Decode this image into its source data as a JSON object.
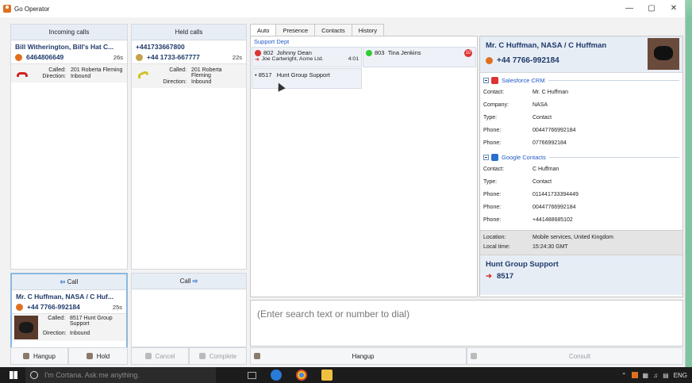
{
  "window": {
    "title": "Go Operator",
    "controls": [
      "—",
      "▢",
      "✕"
    ]
  },
  "incoming": {
    "header": "Incoming calls",
    "name": "Bill Witherington, Bill's Hat C...",
    "number": "6464806649",
    "duration": "26s",
    "called_label": "Called:",
    "called": "201 Roberta Fleming",
    "direction_label": "Direction:",
    "direction": "Inbound"
  },
  "held": {
    "header": "Held calls",
    "name": "+441733667800",
    "number": "+44 1733-667777",
    "duration": "22s",
    "called_label": "Called:",
    "called": "201 Roberta Fleming",
    "direction_label": "Direction:",
    "direction": "Inbound"
  },
  "current": {
    "transfer_left": "Call",
    "transfer_right": "Call",
    "name": "Mr. C Huffman, NASA / C Huf...",
    "number": "+44 7766-992184",
    "duration": "25s",
    "called_label": "Called:",
    "called": "8517 Hunt Group Support",
    "direction_label": "Direction:",
    "direction": "Inbound",
    "buttons": {
      "hangup": "Hangup",
      "hold": "Hold",
      "cancel": "Cancel",
      "complete": "Complete"
    }
  },
  "tabs": [
    {
      "label": "Auto",
      "active": true
    },
    {
      "label": "Presence"
    },
    {
      "label": "Contacts"
    },
    {
      "label": "History"
    }
  ],
  "directory": {
    "group": "Support Dept",
    "cards": [
      {
        "ext": "802",
        "name": "Johnny Dean",
        "status": "busy",
        "sub_name": "Joe Cartwright, Acme Ltd.",
        "sub_time": "4:01"
      },
      {
        "ext": "803",
        "name": "Tina Jenkins",
        "status": "available",
        "badge": "10"
      },
      {
        "ext": "8517",
        "name": "Hunt Group Support",
        "bullet": "•"
      }
    ]
  },
  "info": {
    "name": "Mr. C Huffman, NASA / C Huffman",
    "phone": "+44 7766-992184",
    "salesforce": {
      "title": "Salesforce CRM",
      "rows": [
        [
          "Contact:",
          "Mr. C Huffman"
        ],
        [
          "Company:",
          "NASA"
        ],
        [
          "Type:",
          "Contact"
        ],
        [
          "Phone:",
          "00447766992184"
        ],
        [
          "Phone:",
          "07766992184"
        ]
      ]
    },
    "google": {
      "title": "Google Contacts",
      "rows": [
        [
          "Contact:",
          "C Huffman"
        ],
        [
          "Type:",
          "Contact"
        ],
        [
          "Phone:",
          "011441733394449"
        ],
        [
          "Phone:",
          "00447766992184"
        ],
        [
          "Phone:",
          "+441488685102"
        ]
      ]
    },
    "location_label": "Location:",
    "location": "Mobile services, United Kingdom",
    "local_time_label": "Local time:",
    "local_time": "15:24:30 GMT",
    "hunt_group": "Hunt Group Support",
    "hunt_ext": "8517"
  },
  "search": {
    "placeholder": "(Enter search text or number to dial)"
  },
  "bottom_buttons": {
    "hangup": "Hangup",
    "consult": "Consult"
  },
  "taskbar": {
    "cortana": "I'm Cortana. Ask me anything.",
    "lang": "ENG"
  }
}
